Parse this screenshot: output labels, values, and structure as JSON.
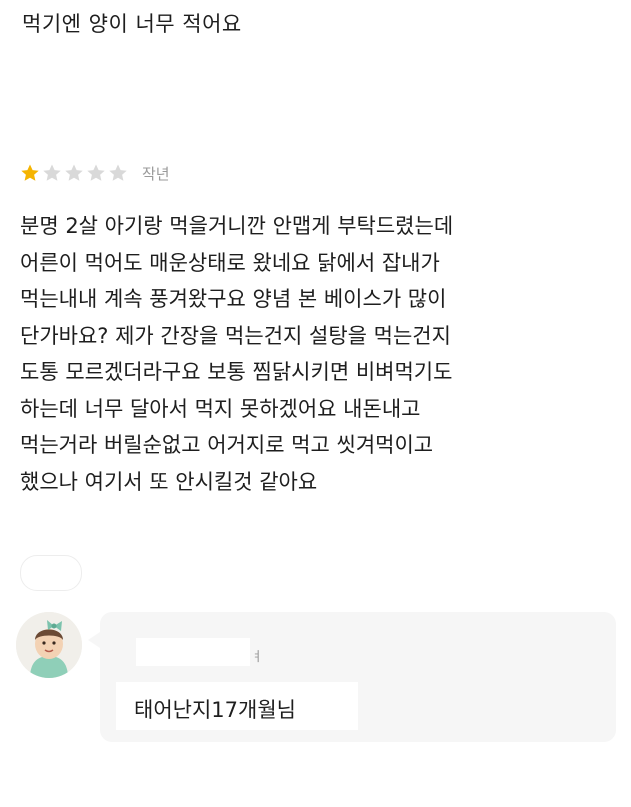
{
  "top_review": {
    "text": "먹기엔 양이 너무 적어요"
  },
  "review": {
    "rating": 1,
    "max_rating": 5,
    "star_color": "#f5b400",
    "empty_star_color": "#d9d9d9",
    "date": "작년",
    "lines": [
      "분명 2살 아기랑 먹을거니깐 안맵게 부탁드렸는데",
      "어른이 먹어도 매운상태로 왔네요 닭에서 잡내가",
      "먹는내내 계속 풍겨왔구요 양념 본 베이스가 많이",
      "단가바요? 제가 간장을 먹는건지 설탕을 먹는건지",
      "도통 모르겠더라구요 보통 찜닭시키면 비벼먹기도",
      "하는데 너무 달아서 먹지 못하겠어요 내돈내고",
      "먹는거라 버릴순없고 어거지로 먹고 씻겨먹이고",
      "했으나 여기서 또 안시킬것 같아요"
    ]
  },
  "owner_reply": {
    "name_suffix": "ㅕ",
    "text": "태어난지17개월님"
  }
}
